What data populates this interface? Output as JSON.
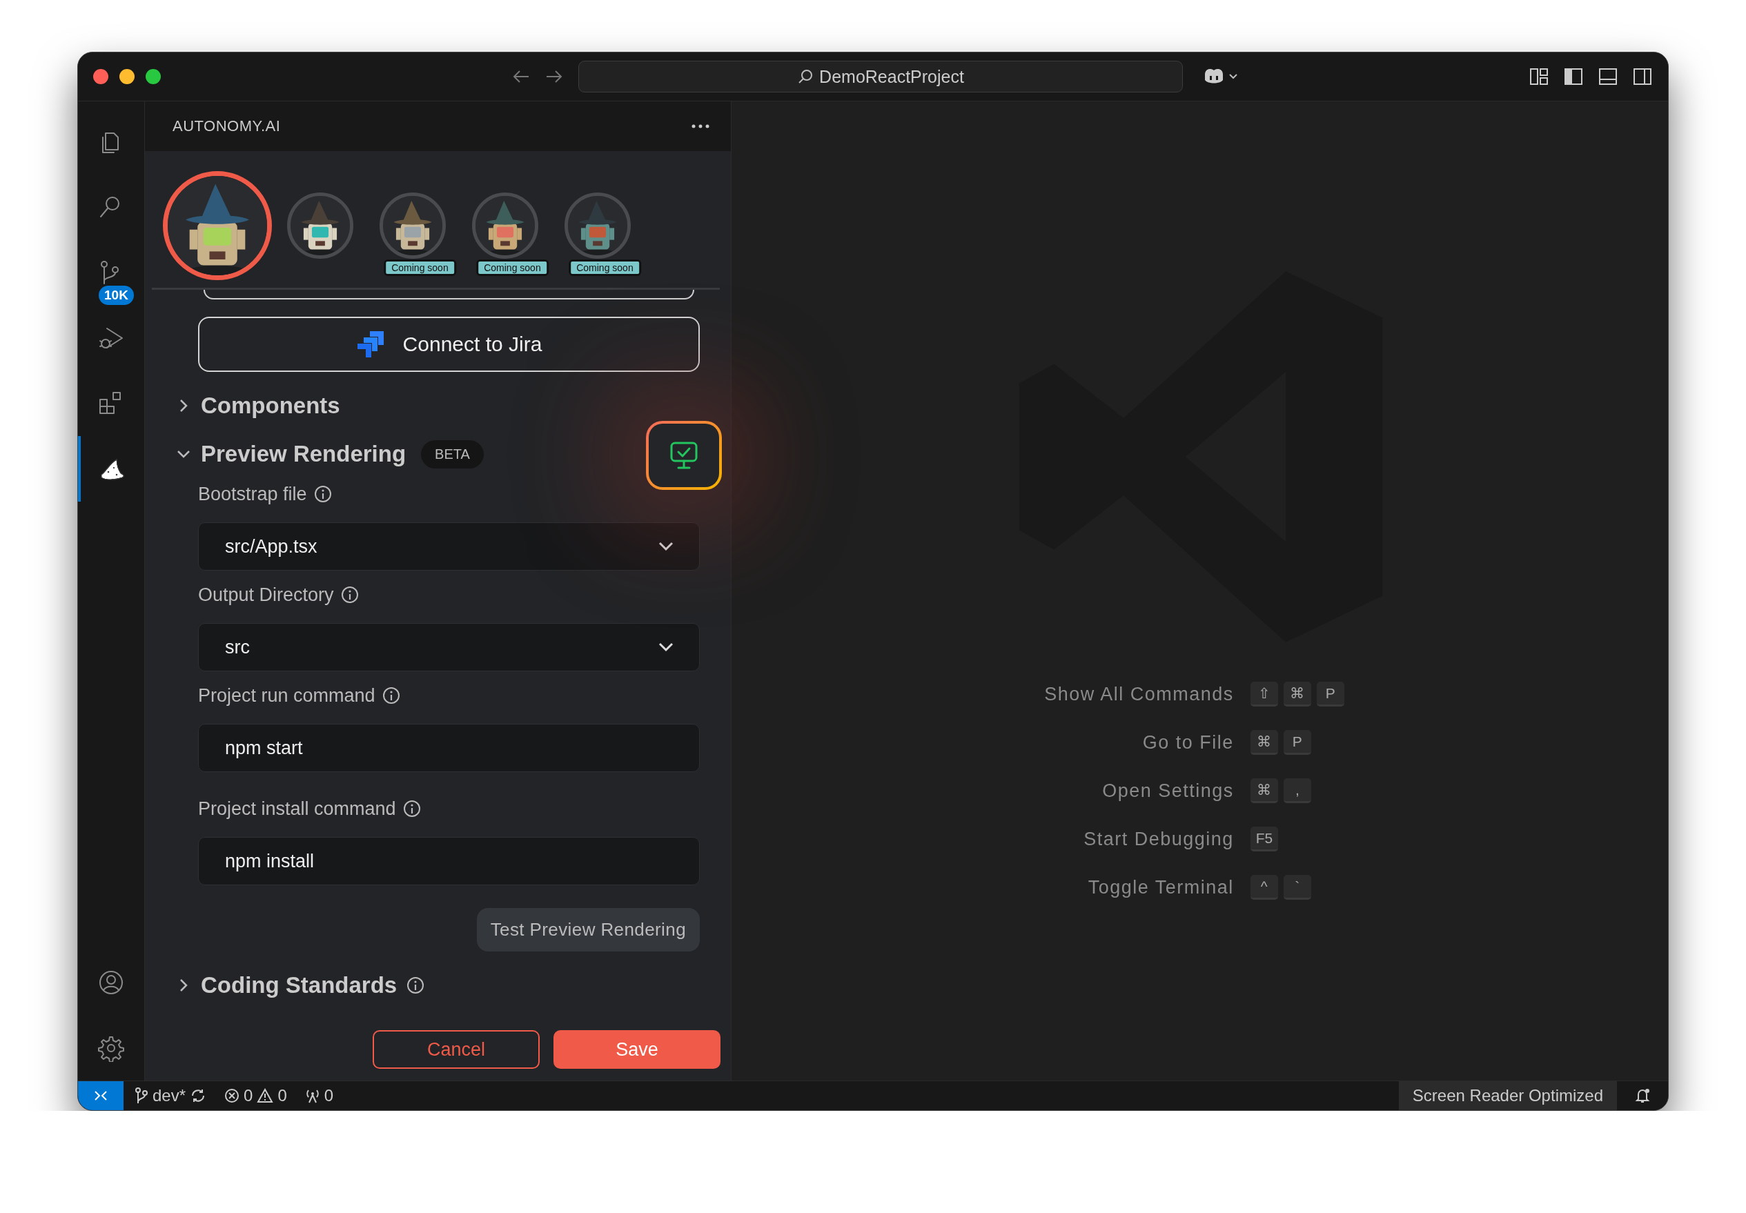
{
  "window": {
    "title": "DemoReactProject"
  },
  "activity_bar": {
    "items": [
      {
        "kind": "files",
        "selected": false
      },
      {
        "kind": "search",
        "selected": false
      },
      {
        "kind": "source-control",
        "selected": false,
        "badge": "10K"
      },
      {
        "kind": "debug",
        "selected": false
      },
      {
        "kind": "extensions",
        "selected": false
      },
      {
        "kind": "wizard",
        "selected": true
      }
    ],
    "bottom": [
      {
        "kind": "account"
      },
      {
        "kind": "settings"
      }
    ]
  },
  "sidebar": {
    "title": "AUTONOMY.AI"
  },
  "agents": [
    {
      "selected": true
    },
    {
      "selected": false
    },
    {
      "selected": false,
      "badge": "Coming soon"
    },
    {
      "selected": false,
      "badge": "Coming soon"
    },
    {
      "selected": false,
      "badge": "Coming soon"
    }
  ],
  "jira_button": "Connect to Jira",
  "sections": [
    {
      "title": "Components",
      "expanded": false
    },
    {
      "title": "Preview Rendering",
      "expanded": true,
      "badge": "BETA",
      "fields": [
        {
          "label": "Bootstrap file",
          "kind": "select",
          "value": "src/App.tsx"
        },
        {
          "label": "Output Directory",
          "kind": "select",
          "value": "src"
        },
        {
          "label": "Project run command",
          "kind": "text",
          "value": "npm start"
        },
        {
          "label": "Project install command",
          "kind": "text",
          "value": "npm install"
        }
      ],
      "test_button": "Test Preview Rendering"
    },
    {
      "title": "Coding Standards",
      "expanded": false,
      "info": true
    }
  ],
  "actions": {
    "cancel": "Cancel",
    "save": "Save"
  },
  "shortcuts": [
    {
      "label": "Show All Commands",
      "keys": [
        "⇧",
        "⌘",
        "P"
      ]
    },
    {
      "label": "Go to File",
      "keys": [
        "⌘",
        "P"
      ]
    },
    {
      "label": "Open Settings",
      "keys": [
        "⌘",
        ","
      ]
    },
    {
      "label": "Start Debugging",
      "keys": [
        "F5"
      ]
    },
    {
      "label": "Toggle Terminal",
      "keys": [
        "^",
        "`"
      ]
    }
  ],
  "status_bar": {
    "branch": "dev*",
    "errors": "0",
    "warnings": "0",
    "ports": "0",
    "screen_reader": "Screen Reader Optimized"
  }
}
